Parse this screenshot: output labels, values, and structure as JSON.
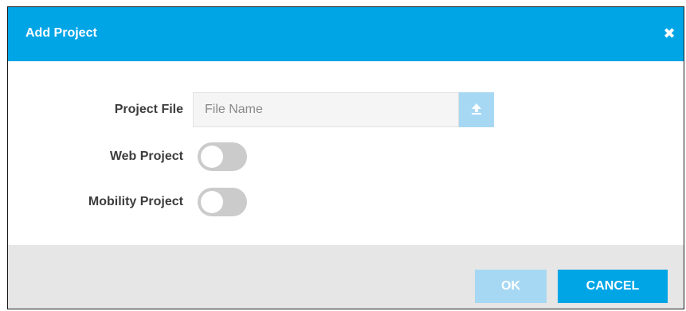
{
  "dialog": {
    "title": "Add Project",
    "close_icon": "close-icon"
  },
  "form": {
    "project_file": {
      "label": "Project File",
      "placeholder": "File Name",
      "value": "",
      "upload_icon": "upload-icon"
    },
    "web_project": {
      "label": "Web Project",
      "enabled": false
    },
    "mobility_project": {
      "label": "Mobility Project",
      "enabled": false
    }
  },
  "footer": {
    "ok_label": "OK",
    "ok_disabled": true,
    "cancel_label": "CANCEL"
  },
  "colors": {
    "accent": "#00a5e6",
    "accent_disabled": "#a7d8f3",
    "footer_background": "#e6e6e6",
    "toggle_off": "#cbcbcb"
  }
}
